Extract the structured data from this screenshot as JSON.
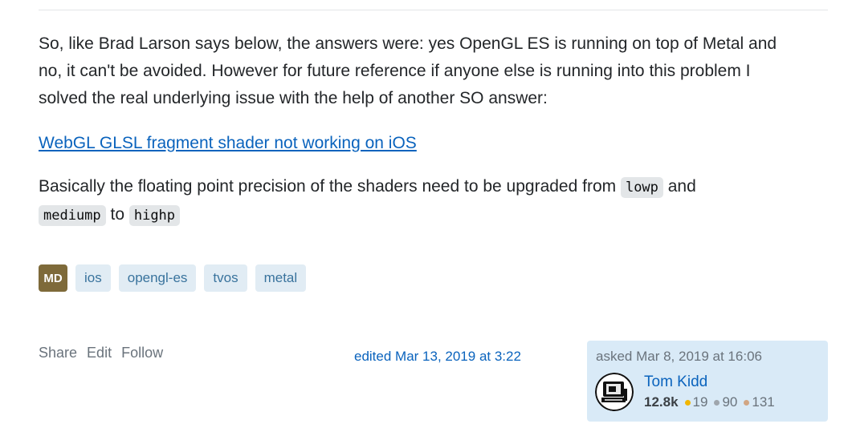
{
  "answer": {
    "p1": "So, like Brad Larson says below, the answers were: yes OpenGL ES is running on top of Metal and no, it can't be avoided. However for future reference if anyone else is running into this problem I solved the real underlying issue with the help of another SO answer:",
    "link": "WebGL GLSL fragment shader not working on iOS",
    "p3_a": "Basically the floating point precision of the shaders need to be upgraded from ",
    "code1": "lowp",
    "p3_b": " and ",
    "code2": "mediump",
    "p3_c": " to ",
    "code3": "highp"
  },
  "tags": {
    "badge": "MD",
    "items": [
      "ios",
      "opengl-es",
      "tvos",
      "metal"
    ]
  },
  "menu": {
    "share": "Share",
    "edit": "Edit",
    "follow": "Follow"
  },
  "edited": "edited Mar 13, 2019 at 3:22",
  "owner": {
    "asked": "asked Mar 8, 2019 at 16:06",
    "name": "Tom Kidd",
    "reputation": "12.8k",
    "gold": "19",
    "silver": "90",
    "bronze": "131",
    "colors": {
      "gold": "#f1b600",
      "silver": "#9fa6ad",
      "bronze": "#d1a684"
    }
  }
}
